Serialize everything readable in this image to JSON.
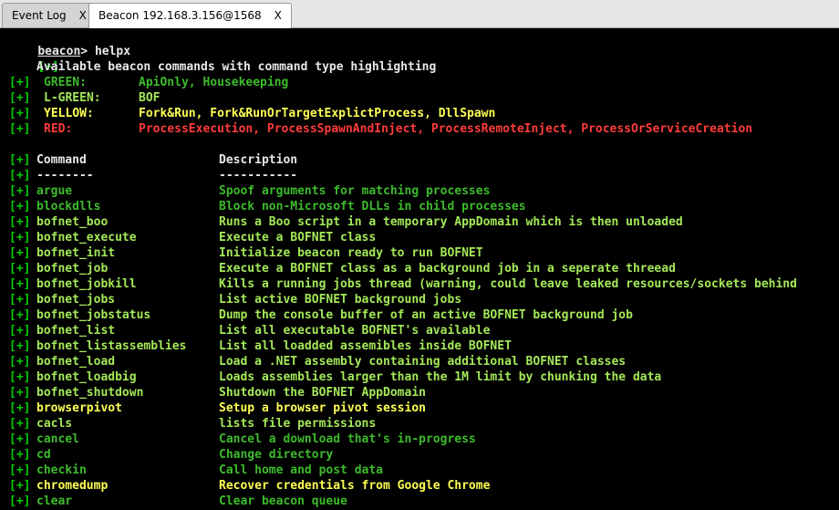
{
  "tabs": [
    {
      "label": "Event Log",
      "close": "X",
      "active": false
    },
    {
      "label": "Beacon 192.168.3.156@1568",
      "close": "X",
      "active": true
    }
  ],
  "prompt": {
    "name": "beacon",
    "symbol": "> ",
    "command": "helpx"
  },
  "banner": "Available beacon commands with command type highlighting",
  "marker": "[+]",
  "colors": {
    "green": "#3dbb2c",
    "lgreen": "#a4e858",
    "yellow": "#ffff55",
    "red": "#ff3a3a",
    "marker": "#00d000",
    "white": "#e8e8e8"
  },
  "legend": [
    {
      "label": "GREEN:",
      "types": "ApiOnly, Housekeeping",
      "color": "green"
    },
    {
      "label": "L-GREEN:",
      "types": "BOF",
      "color": "lgreen"
    },
    {
      "label": "YELLOW:",
      "types": "Fork&Run, Fork&RunOrTargetExplictProcess, DllSpawn",
      "color": "yellow"
    },
    {
      "label": "RED:",
      "types": "ProcessExecution, ProcessSpawnAndInject, ProcessRemoteInject, ProcessOrServiceCreation",
      "color": "red"
    }
  ],
  "header": {
    "command": "Command",
    "description": "Description",
    "command_rule": "--------",
    "description_rule": "-----------"
  },
  "commands": [
    {
      "name": "argue",
      "desc": "Spoof arguments for matching processes",
      "color": "green"
    },
    {
      "name": "blockdlls",
      "desc": "Block non-Microsoft DLLs in child processes",
      "color": "green"
    },
    {
      "name": "bofnet_boo",
      "desc": "Runs a Boo script in a temporary AppDomain which is then unloaded",
      "color": "lgreen"
    },
    {
      "name": "bofnet_execute",
      "desc": "Execute a BOFNET class",
      "color": "lgreen"
    },
    {
      "name": "bofnet_init",
      "desc": "Initialize beacon ready to run BOFNET",
      "color": "lgreen"
    },
    {
      "name": "bofnet_job",
      "desc": "Execute a BOFNET class as a background job in a seperate threead",
      "color": "lgreen"
    },
    {
      "name": "bofnet_jobkill",
      "desc": "Kills a running jobs thread (warning, could leave leaked resources/sockets behind",
      "color": "lgreen"
    },
    {
      "name": "bofnet_jobs",
      "desc": "List active BOFNET background jobs",
      "color": "lgreen"
    },
    {
      "name": "bofnet_jobstatus",
      "desc": "Dump the console buffer of an active BOFNET background job",
      "color": "lgreen"
    },
    {
      "name": "bofnet_list",
      "desc": "List all executable BOFNET's available",
      "color": "lgreen"
    },
    {
      "name": "bofnet_listassemblies",
      "desc": "List all loadded assemibles inside BOFNET",
      "color": "lgreen"
    },
    {
      "name": "bofnet_load",
      "desc": "Load a .NET assembly containing additional BOFNET classes",
      "color": "lgreen"
    },
    {
      "name": "bofnet_loadbig",
      "desc": "Loads assemblies larger than the 1M limit by chunking the data",
      "color": "lgreen"
    },
    {
      "name": "bofnet_shutdown",
      "desc": "Shutdown the BOFNET AppDomain",
      "color": "lgreen"
    },
    {
      "name": "browserpivot",
      "desc": "Setup a browser pivot session",
      "color": "yellow"
    },
    {
      "name": "cacls",
      "desc": "lists file permissions",
      "color": "lgreen"
    },
    {
      "name": "cancel",
      "desc": "Cancel a download that's in-progress",
      "color": "green"
    },
    {
      "name": "cd",
      "desc": "Change directory",
      "color": "green"
    },
    {
      "name": "checkin",
      "desc": "Call home and post data",
      "color": "green"
    },
    {
      "name": "chromedump",
      "desc": "Recover credentials from Google Chrome",
      "color": "yellow"
    },
    {
      "name": "clear",
      "desc": "Clear beacon queue",
      "color": "green"
    }
  ]
}
